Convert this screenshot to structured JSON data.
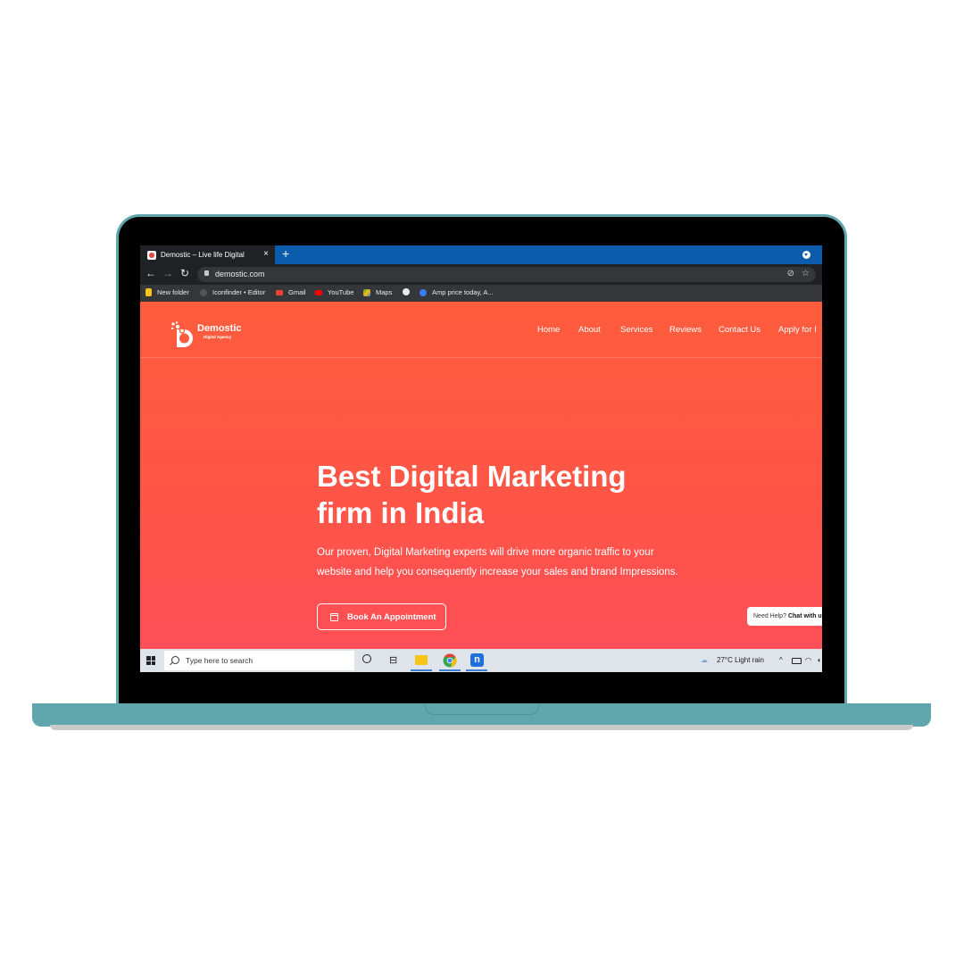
{
  "browser": {
    "tab_title": "Demostic – Live life Digital",
    "tab_close": "×",
    "new_tab": "+",
    "url": "demostic.com",
    "bookmarks": [
      "New folder",
      "Iconfinder • Editor",
      "Gmail",
      "YouTube",
      "Maps",
      "",
      "Amp price today, A..."
    ]
  },
  "site": {
    "logo_name": "Demostic",
    "logo_sub": "Digital Agency",
    "nav": [
      "Home",
      "About",
      "Services",
      "Reviews",
      "Contact Us",
      "Apply for I"
    ],
    "hero_title_line1": "Best Digital Marketing",
    "hero_title_line2": "firm in India",
    "hero_desc_line1": "Our proven, Digital Marketing experts will drive more organic traffic to your",
    "hero_desc_line2": "website and help you consequently increase your sales and brand Impressions.",
    "cta_label": "Book An Appointment",
    "chat_prefix": "Need Help?",
    "chat_link": "Chat with u"
  },
  "taskbar": {
    "search_placeholder": "Type here to search",
    "weather": "27°C  Light rain"
  },
  "colors": {
    "laptop_frame": "#5fa6ad",
    "tabbar": "#0b5cad",
    "hero_top": "#ff5c3d",
    "hero_bottom": "#ff4f58"
  }
}
